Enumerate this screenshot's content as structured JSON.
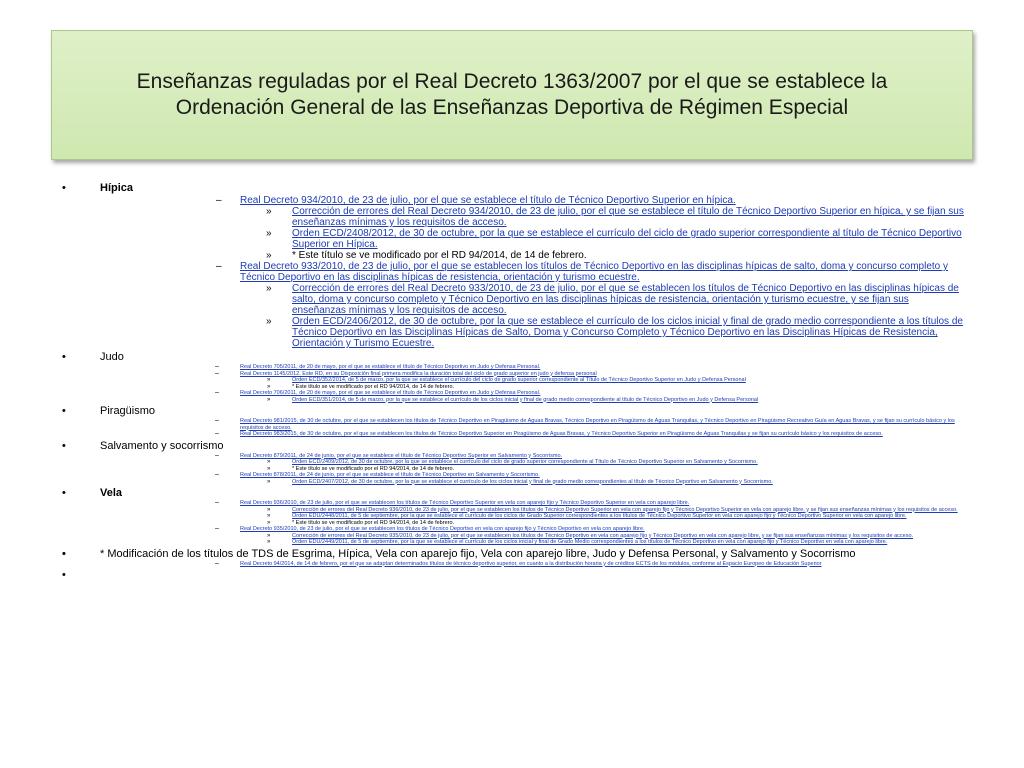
{
  "title": "Enseñanzas reguladas por el Real Decreto 1363/2007 por el que se establece la Ordenación General de las Enseñanzas Deportiva de Régimen Especial",
  "bullets": {
    "l1": "•",
    "l2": "–",
    "l3": "»"
  },
  "sections": [
    {
      "heading": "Hípica",
      "bold": true,
      "size": "large",
      "items": [
        {
          "text": "Real Decreto 934/2010, de 23 de julio, por el que se establece el título de Técnico Deportivo Superior en hípica.",
          "link": true,
          "sub": [
            {
              "text": "Corrección de errores del Real Decreto 934/2010, de 23 de julio, por el que se establece el título de Técnico Deportivo Superior en hípica, y se fijan sus enseñanzas mínimas y los requisitos de acceso.",
              "link": true
            },
            {
              "text": "Orden ECD/2408/2012, de 30 de octubre, por la que se establece el currículo del ciclo de grado superior correspondiente al título de Técnico Deportivo Superior en Hípica.",
              "link": true
            },
            {
              "text": "* Este título se ve modificado por el RD 94/2014, de 14 de febrero.",
              "link": false
            }
          ]
        },
        {
          "text": "Real Decreto 933/2010, de 23 de julio, por el que se establecen los títulos de Técnico Deportivo en las disciplinas hípicas de salto, doma y concurso completo y Técnico Deportivo en las disciplinas hípicas de resistencia, orientación y turismo ecuestre.",
          "link": true,
          "sub": [
            {
              "text": "Corrección de errores del Real Decreto 933/2010, de 23 de julio, por el que se establecen los títulos de Técnico Deportivo en las disciplinas hípicas de salto, doma y concurso completo y Técnico Deportivo en las disciplinas hípicas de resistencia, orientación y turismo ecuestre, y se fijan sus enseñanzas mínimas y los requisitos de acceso.",
              "link": true
            },
            {
              "text": "Orden ECD/2406/2012, de 30 de octubre, por la que se establece el currículo de los ciclos inicial y final de grado medio correspondiente a los títulos de Técnico Deportivo en las Disciplinas Hípicas de Salto, Doma y Concurso Completo y Técnico Deportivo en las Disciplinas Hípicas de Resistencia, Orientación y Turismo Ecuestre.",
              "link": true
            }
          ]
        }
      ]
    },
    {
      "heading": "Judo",
      "bold": false,
      "size": "small",
      "items": [
        {
          "text": "Real Decreto 705/2011, de 20 de mayo, por el que se establece el título de Técnico Deportivo en Judo y Defensa Personal.",
          "link": true,
          "sub": []
        },
        {
          "text": "Real Decreto 1145/2012. Este RD, en su Disposición final primera modifica la duración total del ciclo de grado superior en judo y defensa personal",
          "link": true,
          "sub": [
            {
              "text": "Orden ECD/352/2014, de 5 de marzo, por la que se establece el currículo del ciclo de grado superior correspondiente al Título de Técnico Deportivo Superior en Judo y Defensa Personal",
              "link": true
            },
            {
              "text": "* Este título se ve modificado por el RD 94/2014, de 14 de febrero.",
              "link": false
            }
          ]
        },
        {
          "text": "Real Decreto 706/2011, de 20 de mayo, por el que se establece el título de Técnico Deportivo en Judo y Defensa Personal.",
          "link": true,
          "sub": [
            {
              "text": "Orden ECD/351/2014, de 5 de marzo, por la que se establece el currículo de los ciclos inicial y final de grado medio correspondiente al título de Técnico Deportivo en Judo y Defensa Personal",
              "link": true
            }
          ]
        }
      ]
    },
    {
      "heading": "Piragüismo",
      "bold": false,
      "size": "small",
      "items": [
        {
          "text": "Real Decreto 981/2015, de 30 de octubre, por el que se establecen los títulos de Técnico Deportivo en Piragüismo de Aguas Bravas, Técnico Deportivo en Piragüismo de Aguas Tranquilas, y Técnico Deportivo en Piragüismo Recreativo Guía en Aguas Bravas, y se fijan su currículo básico y los requisitos de acceso.",
          "link": true,
          "sub": []
        },
        {
          "text": "Real Decreto 983/2015, de 30 de octubre, por el que se establecen los títulos de Técnico Deportivo Superior en Piragüismo de Aguas Bravas, y Técnico Deportivo Superior en Piragüismo de Aguas Tranquilas y se fijan su currículo básico y los requisitos de acceso.",
          "link": true,
          "sub": []
        }
      ]
    },
    {
      "heading": "Salvamento y socorrismo",
      "bold": false,
      "size": "small",
      "items": [
        {
          "text": "Real Decreto 879/2011, de 24 de junio, por el que se establece el título de Técnico Deportivo Superior en Salvamento y Socorrismo.",
          "link": true,
          "sub": [
            {
              "text": "Orden ECD/2409/2012, de 30 de octubre, por la que se establece el currículo del ciclo de grado superior correspondiente al Título de Técnico Deportivo Superior en Salvamento y Socorrismo.",
              "link": true
            },
            {
              "text": "* Este título se ve modificado por el RD 94/2014, de 14 de febrero.",
              "link": false
            }
          ]
        },
        {
          "text": "Real Decreto 878/2011, de 24 de junio, por el que se establece el título de Técnico Deportivo en Salvamento y Socorrismo.",
          "link": true,
          "sub": [
            {
              "text": "Orden ECD/2407/2012, de 30 de octubre, por la que se establece el currículo de los ciclos inicial y final de grado medio correspondientes al título de Técnico Deportivo en Salvamento y Socorrismo.",
              "link": true
            }
          ]
        }
      ]
    },
    {
      "heading": "Vela",
      "bold": true,
      "size": "small",
      "items": [
        {
          "text": "Real Decreto 936/2010, de 23 de julio, por el que se establecen los títulos de Técnico Deportivo Superior en vela con aparejo fijo y Técnico Deportivo Superior en vela con aparejo libre.",
          "link": true,
          "sub": [
            {
              "text": "Corrección de errores del Real Decreto 936/2010, de 23 de julio, por el que se establecen los títulos de Técnico Deportivo Superior en vela con aparejo fijo y Técnico Deportivo Superior en vela con aparejo libre, y se fijan sus enseñanzas mínimas y los requisitos de acceso.",
              "link": true
            },
            {
              "text": "Orden EDU/2448/2011, de 5 de septiembre, por la que se establece el currículo de los ciclos de Grado Superior correspondientes a los títulos de Técnico Deportivo Superior en vela con aparejo fijo y Técnico Deportivo Superior en vela con aparejo libre.",
              "link": true
            },
            {
              "text": "* Este título se ve modificado por el RD 94/2014, de 14 de febrero.",
              "link": false
            }
          ]
        },
        {
          "text": "Real Decreto 935/2010, de 23 de julio, por el que se establecen los títulos de Técnico Deportivo en vela con aparejo fijo y Técnico Deportivo en vela con aparejo libre.",
          "link": true,
          "sub": [
            {
              "text": "Corrección de errores del Real Decreto 935/2010, de 23 de julio, por el que se establecen los títulos de Técnico Deportivo en vela con aparejo fijo y Técnico Deportivo en vela con aparejo libre, y se fijan sus enseñanzas mínimas y los requisitos de acceso.",
              "link": true
            },
            {
              "text": "Orden EDU/2449/2011, de 5 de septiembre, por la que se establece el currículo de los ciclos inicial y final de Grado Medio correspondientes a los títulos de Técnico Deportivo en vela con aparejo fijo y Técnico Deportivo en vela con aparejo libre.",
              "link": true
            }
          ]
        }
      ]
    },
    {
      "heading": "",
      "bold": false,
      "size": "small",
      "items": []
    },
    {
      "heading": "* Modificación de los títulos de TDS de Esgrima, Hípica, Vela con aparejo fijo, Vela con aparejo libre, Judo y Defensa Personal, y Salvamento y Socorrismo",
      "bold": false,
      "size": "small",
      "items": [
        {
          "text": "Real Decreto 94/2014, de 14 de febrero, por el que se adaptan determinados títulos de técnico deportivo superior, en cuanto a la distribución horaria y de créditos ECTS de los módulos, conforme al Espacio Europeo de Educación Superior",
          "link": true,
          "sub": []
        }
      ]
    },
    {
      "heading": "",
      "bold": false,
      "size": "small",
      "items": []
    }
  ]
}
